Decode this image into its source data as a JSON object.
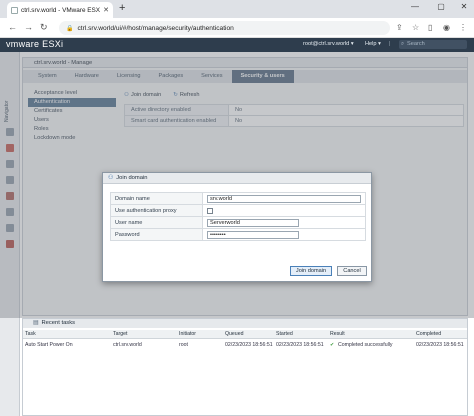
{
  "browser": {
    "tab_title": "ctrl.srv.world - VMware ESXi",
    "new_tab": "+",
    "url": "ctrl.srv.world/ui/#/host/manage/security/authentication"
  },
  "header": {
    "logo_brand": "vm",
    "logo_text": "ware",
    "logo_product": "ESXi",
    "user": "root@ctrl.srv.world",
    "help": "Help",
    "search_placeholder": "Search"
  },
  "rail": {
    "label": "Navigator"
  },
  "panel": {
    "title": "ctrl.srv.world - Manage",
    "tabs": [
      "System",
      "Hardware",
      "Licensing",
      "Packages",
      "Services",
      "Security & users"
    ],
    "active_tab": 5
  },
  "subnav": {
    "items": [
      "Acceptance level",
      "Authentication",
      "Certificates",
      "Users",
      "Roles",
      "Lockdown mode"
    ],
    "active": 1
  },
  "actions": {
    "join_domain": "Join domain",
    "refresh": "Refresh"
  },
  "auth_settings": [
    {
      "key": "Active directory enabled",
      "value": "No"
    },
    {
      "key": "Smart card authentication enabled",
      "value": "No"
    }
  ],
  "dialog": {
    "title": "Join domain",
    "domain_name_label": "Domain name",
    "domain_name_value": "srv.world",
    "use_proxy_label": "Use authentication proxy",
    "username_label": "User name",
    "username_value": "Serverworld",
    "password_label": "Password",
    "password_value": "••••••••",
    "join_button": "Join domain",
    "cancel_button": "Cancel"
  },
  "tasks": {
    "title": "Recent tasks",
    "columns": [
      "Task",
      "Target",
      "Initiator",
      "Queued",
      "Started",
      "Result",
      "Completed"
    ],
    "rows": [
      {
        "task": "Auto Start Power On",
        "target": "ctrl.srv.world",
        "initiator": "root",
        "queued": "02/23/2023 18:56:51",
        "started": "02/23/2023 18:56:51",
        "result": "Completed successfully",
        "completed": "02/23/2023 18:56:51"
      }
    ]
  },
  "colors": {
    "header": "#2e3d4d",
    "accent": "#4f6e8c",
    "success": "#3c9b3c"
  }
}
